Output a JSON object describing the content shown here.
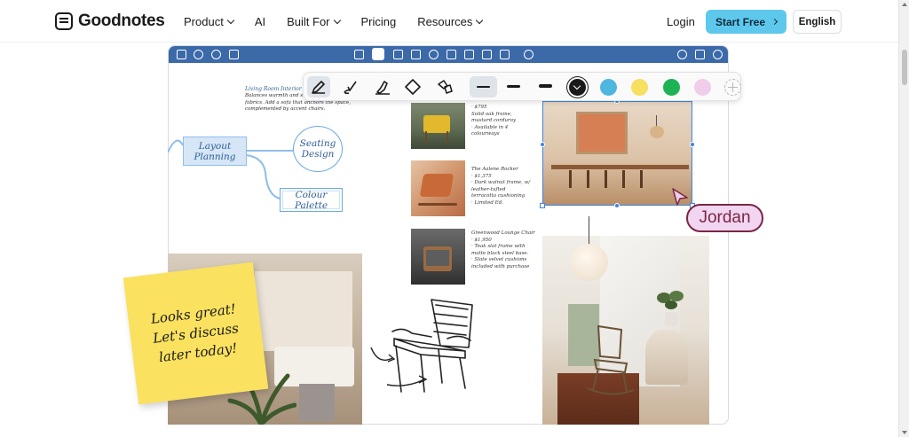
{
  "nav": {
    "brand": "Goodnotes",
    "links": [
      {
        "label": "Product",
        "dropdown": true
      },
      {
        "label": "AI",
        "dropdown": false
      },
      {
        "label": "Built For",
        "dropdown": true
      },
      {
        "label": "Pricing",
        "dropdown": false
      },
      {
        "label": "Resources",
        "dropdown": true
      }
    ],
    "login": "Login",
    "start_free": "Start Free",
    "language": "English"
  },
  "colors": {
    "accent": "#5ec8ec",
    "app_bar": "#3c69a8",
    "selection": "#3a86e8",
    "cursor_tag": "#7a2743"
  },
  "palette": {
    "tools": [
      "pen-icon",
      "brush-icon",
      "highlighter-icon",
      "eraser-icon",
      "lasso-icon"
    ],
    "strokes": [
      "thin",
      "medium",
      "thick"
    ],
    "swatches": [
      {
        "name": "black",
        "color": "#1a1a1a"
      },
      {
        "name": "blue",
        "color": "#4fb6e0"
      },
      {
        "name": "yellow",
        "color": "#f7df5f"
      },
      {
        "name": "green",
        "color": "#1db354"
      },
      {
        "name": "pink",
        "color": "#f0cde8"
      }
    ]
  },
  "canvas": {
    "notes_title": "Living Room Interior Des",
    "notes_body": "Balances warmth and str... palette layered with textured fabrics. Add a sofa that anchors the space, complemented by accent chairs.",
    "mindmap": {
      "layout": "Layout Planning",
      "seating": "Seating Design",
      "colour": "Colour Palette"
    },
    "products": [
      {
        "price": "· $795",
        "lines": [
          "Solid oak frame,",
          "mustard corduroy",
          "· Available in 4 colourways"
        ]
      },
      {
        "price": "The Aalene Rocker",
        "lines": [
          "· $1,375",
          "· Dark walnut frame, w/",
          "leather-tufted",
          "terracotta cushioning",
          "· Limited Ed."
        ]
      },
      {
        "price": "Greenwood Lounge Chair",
        "lines": [
          "· $1,950",
          "· Teak slat frame with",
          "matte black steel base.",
          "· Slate velvet cushions",
          "included with purchase"
        ]
      }
    ],
    "collaborator": "Jordan",
    "sticky_note": "Looks great! Let's discuss later today!"
  }
}
